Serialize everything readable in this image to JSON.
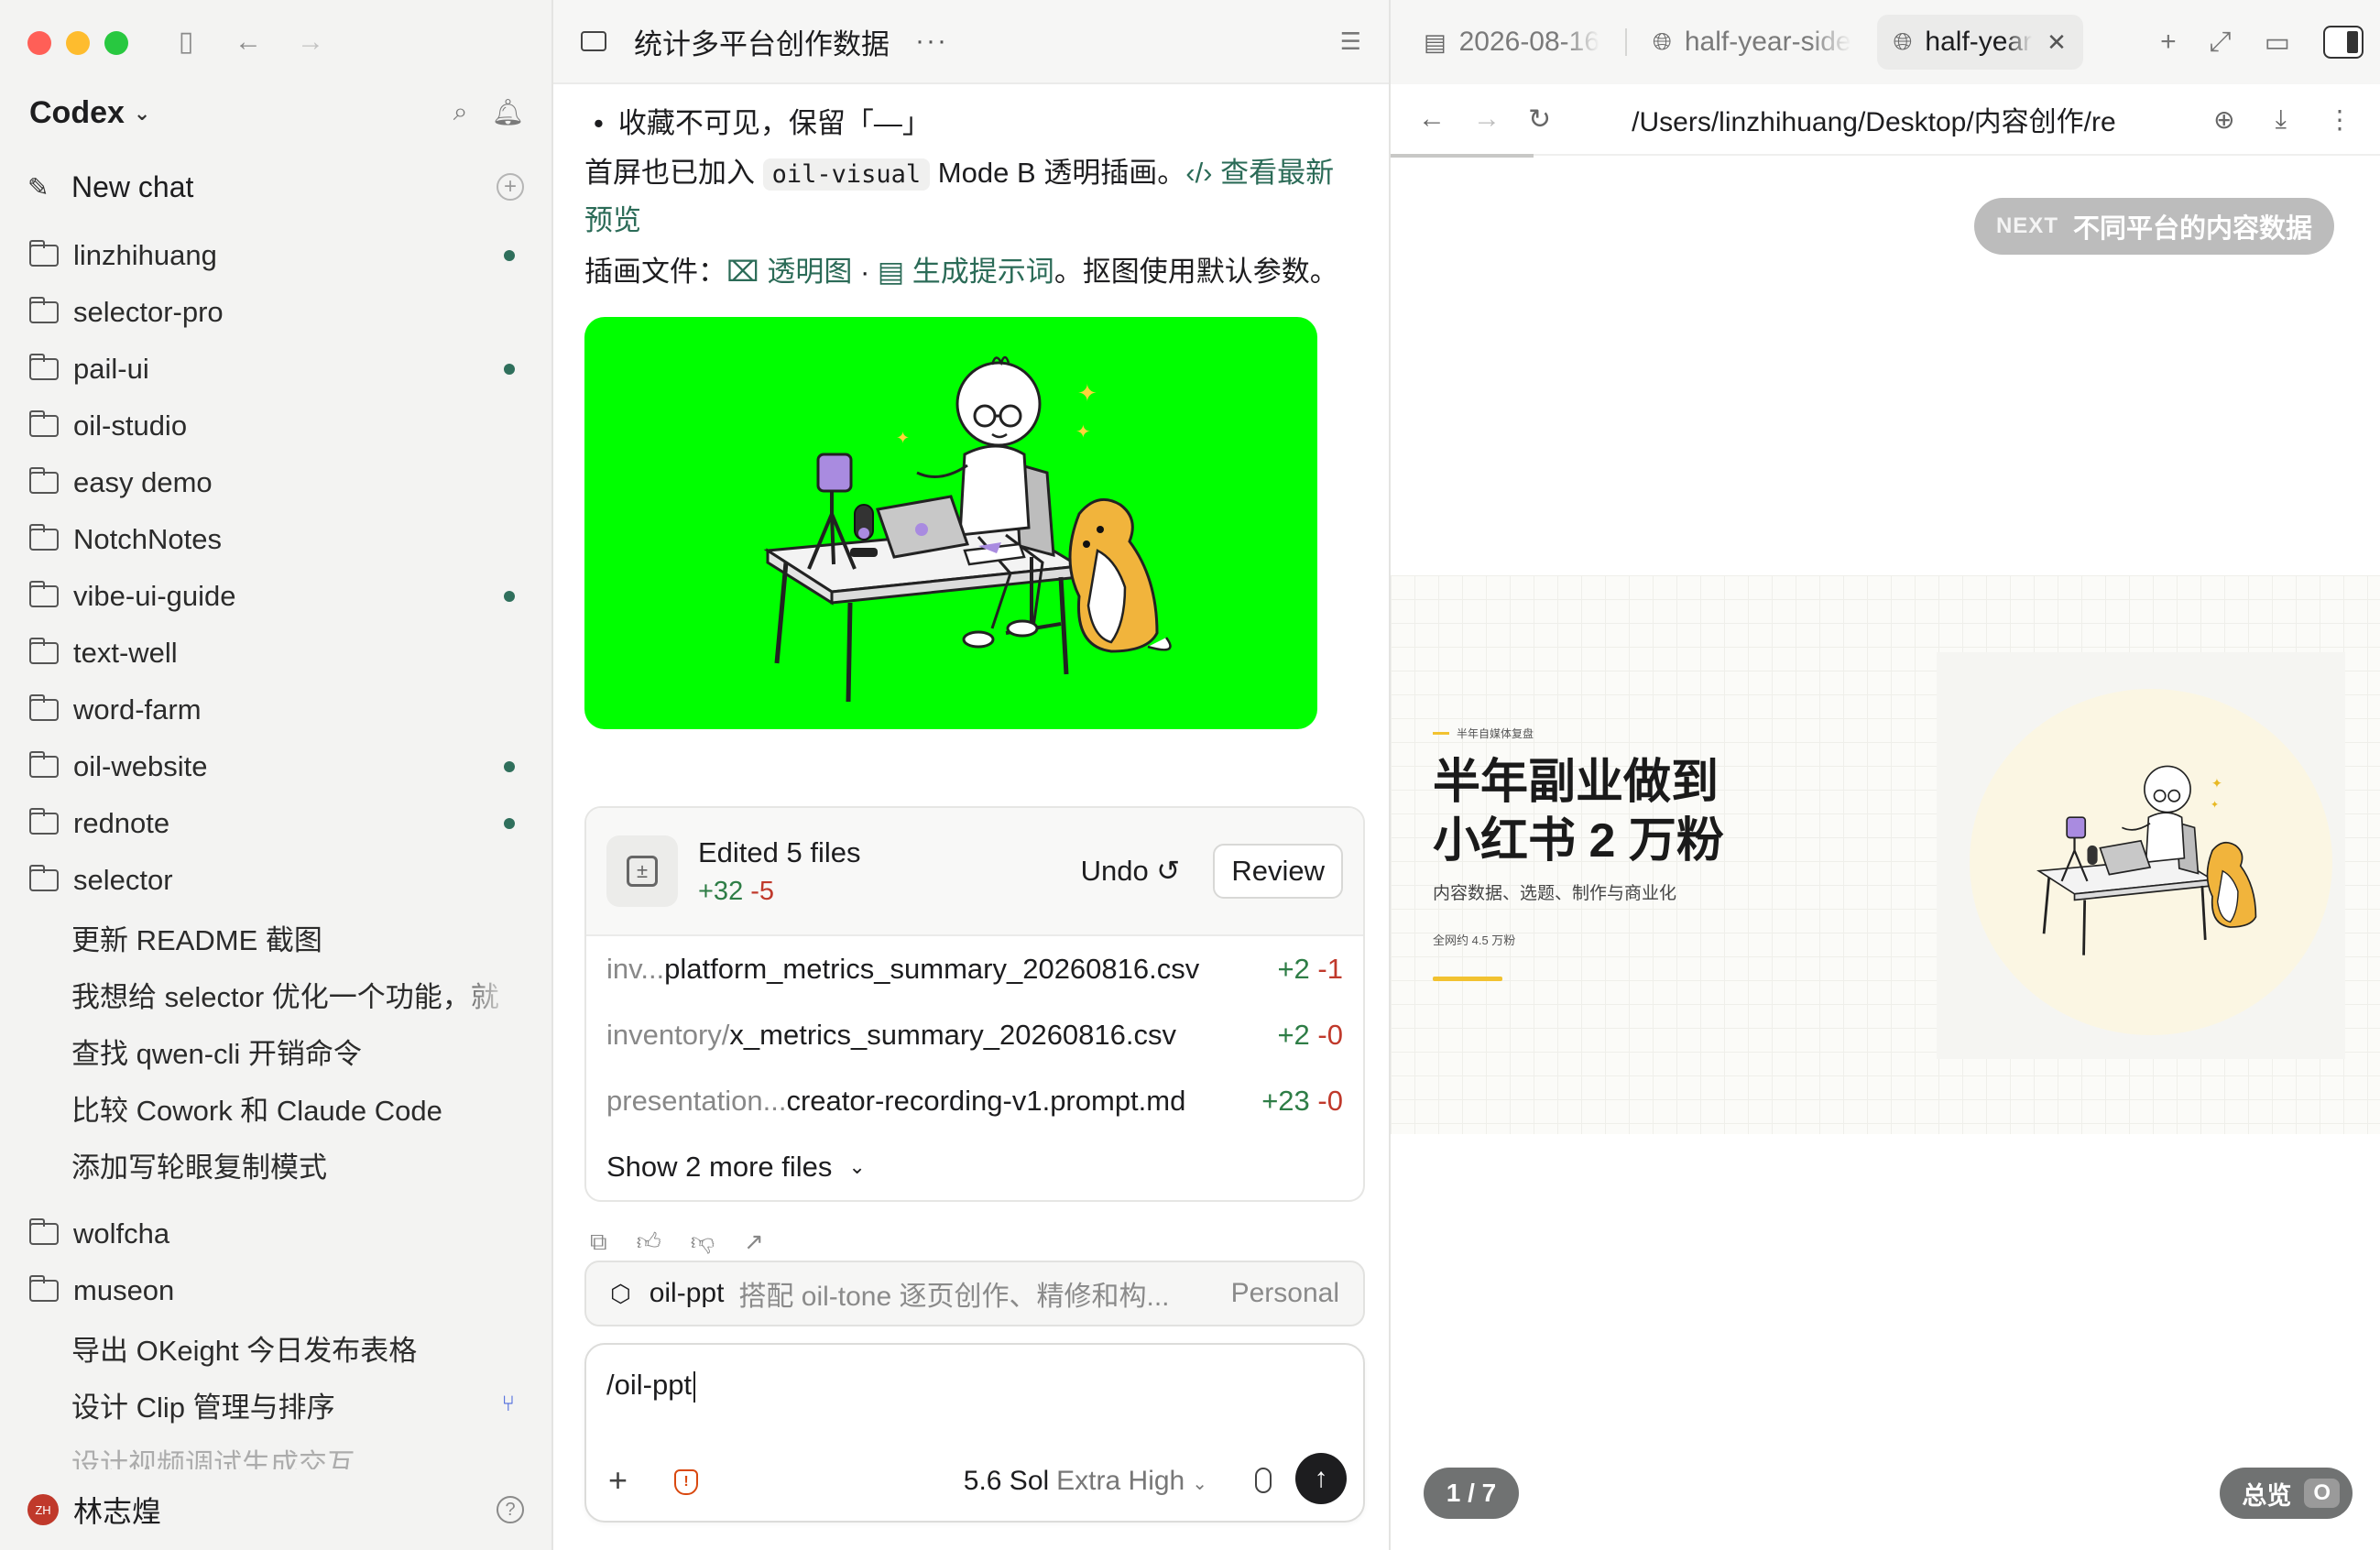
{
  "sidebar": {
    "brand": "Codex",
    "new_chat": "New chat",
    "projects": [
      {
        "label": "linzhihuang",
        "dot": true
      },
      {
        "label": "selector-pro",
        "dot": false
      },
      {
        "label": "pail-ui",
        "dot": true
      },
      {
        "label": "oil-studio",
        "dot": false
      },
      {
        "label": "easy demo",
        "dot": false
      },
      {
        "label": "NotchNotes",
        "dot": false
      },
      {
        "label": "vibe-ui-guide",
        "dot": true
      },
      {
        "label": "text-well",
        "dot": false
      },
      {
        "label": "word-farm",
        "dot": false
      },
      {
        "label": "oil-website",
        "dot": true
      },
      {
        "label": "rednote",
        "dot": true
      },
      {
        "label": "selector",
        "dot": false
      }
    ],
    "selector_chats": [
      "更新 README 截图",
      "我想给 selector 优化一个功能，就",
      "查找 qwen-cli 开销命令",
      "比较 Cowork 和 Claude Code",
      "添加写轮眼复制模式"
    ],
    "more_projects": [
      {
        "label": "wolfcha"
      },
      {
        "label": "museon"
      }
    ],
    "museon_chats": [
      "导出 OKeight 今日发布表格",
      "设计 Clip 管理与排序",
      "设计视频调试生成交互"
    ],
    "user": {
      "initials": "ZH",
      "name": "林志煌"
    }
  },
  "chat": {
    "title": "统计多平台创作数据",
    "bullet": "收藏不可见，保留「—」",
    "p1_pre": "首屏也已加入 ",
    "p1_code": "oil-visual",
    "p1_mid": " Mode B 透明插画。",
    "p1_link": "‹/› 查看最新预览",
    "p2_label": "插画文件：",
    "p2_link1": "⌧ 透明图",
    "p2_sep": " · ",
    "p2_link2": "▤ 生成提示词",
    "p2_tail": "。抠图使用默认参数。",
    "edit_card": {
      "title": "Edited 5 files",
      "plus": "+32",
      "minus": "-5",
      "undo": "Undo ↺",
      "review": "Review",
      "files": [
        {
          "path": "inv... ",
          "name": "platform_metrics_summary_20260816.csv",
          "plus": "+2",
          "minus": "-1"
        },
        {
          "path": "inventory/",
          "name": "x_metrics_summary_20260816.csv",
          "plus": "+2",
          "minus": "-0"
        },
        {
          "path": "presentation...",
          "name": "creator-recording-v1.prompt.md",
          "plus": "+23",
          "minus": "-0"
        }
      ],
      "show_more": "Show 2 more files"
    },
    "skill": {
      "name": "oil-ppt",
      "desc": "搭配 oil-tone 逐页创作、精修和构...",
      "tag": "Personal"
    },
    "composer": {
      "value": "/oil-ppt",
      "model": "5.6 Sol",
      "level": "Extra High"
    }
  },
  "preview": {
    "tabs": [
      {
        "label": "2026-08-16",
        "icon": "doc"
      },
      {
        "label": "half-year-side",
        "icon": "globe"
      },
      {
        "label": "half-year",
        "icon": "globe",
        "active": true
      }
    ],
    "url": "/Users/linzhihuang/Desktop/内容创作/re",
    "next_kw": "NEXT",
    "next_label": "不同平台的内容数据",
    "slide": {
      "kicker": "半年自媒体复盘",
      "title_l1": "半年副业做到",
      "title_l2": "小红书 2 万粉",
      "subtitle": "内容数据、选题、制作与商业化",
      "footnote": "全网约 4.5 万粉"
    },
    "pager": "1 / 7",
    "overview": "总览",
    "overview_key": "O"
  },
  "colors": {
    "accent": "#2b6b57",
    "plus": "#2e7d46",
    "minus": "#c0392b",
    "green_screen": "#00ff00",
    "slide_yellow": "#f2c230"
  }
}
